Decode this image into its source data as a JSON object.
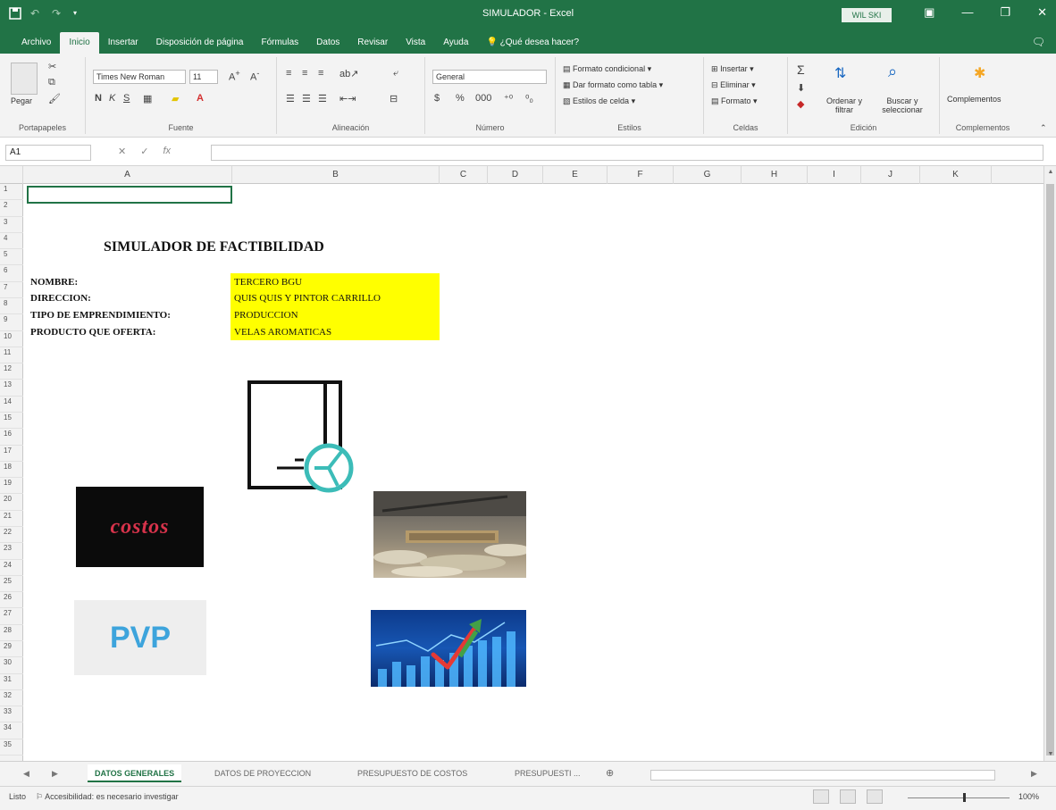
{
  "window": {
    "title": "SIMULADOR - Excel",
    "user": "WIL SKI"
  },
  "ribbon_tabs": [
    "Archivo",
    "Inicio",
    "Insertar",
    "Disposición de página",
    "Fórmulas",
    "Datos",
    "Revisar",
    "Vista",
    "Ayuda"
  ],
  "active_tab": "Inicio",
  "tell_me": "¿Qué desea hacer?",
  "ribbon": {
    "clipboard": {
      "paste": "Pegar",
      "label": "Portapapeles"
    },
    "font": {
      "name": "Times New Roman",
      "size": "11",
      "label": "Fuente"
    },
    "alignment": {
      "label": "Alineación"
    },
    "number": {
      "format": "General",
      "label": "Número"
    },
    "styles": {
      "conditional": "Formato condicional",
      "table": "Dar formato como tabla",
      "cell": "Estilos de celda",
      "label": "Estilos"
    },
    "cells": {
      "insert": "Insertar",
      "delete": "Eliminar",
      "format": "Formato",
      "label": "Celdas"
    },
    "editing": {
      "sort": "Ordenar y filtrar",
      "find": "Buscar y seleccionar",
      "label": "Edición"
    },
    "addins": {
      "label": "Complementos",
      "group": "Complementos"
    }
  },
  "formula_bar": {
    "name_box": "A1",
    "content": ""
  },
  "columns": [
    "A",
    "B",
    "C",
    "D",
    "E",
    "F",
    "G",
    "H",
    "I",
    "J",
    "K"
  ],
  "rows": [
    "1",
    "2",
    "3",
    "4",
    "5",
    "6",
    "7",
    "8",
    "9",
    "10",
    "11",
    "12",
    "13",
    "14",
    "15",
    "16",
    "17",
    "18",
    "19",
    "20",
    "21",
    "22",
    "23",
    "24",
    "25",
    "26",
    "27",
    "28",
    "29",
    "30",
    "31",
    "32",
    "33",
    "34",
    "35"
  ],
  "sheet": {
    "title": "SIMULADOR DE FACTIBILIDAD",
    "fields": [
      {
        "label": "NOMBRE:",
        "value": "TERCERO BGU"
      },
      {
        "label": "DIRECCION:",
        "value": "QUIS QUIS Y PINTOR CARRILLO"
      },
      {
        "label": "TIPO DE EMPRENDIMIENTO:",
        "value": "PRODUCCION"
      },
      {
        "label": "PRODUCTO QUE OFERTA:",
        "value": "VELAS AROMATICAS"
      }
    ],
    "images": {
      "costos": "costos",
      "pvp": "PVP"
    }
  },
  "sheet_tabs": [
    "DATOS GENERALES",
    "DATOS DE PROYECCION",
    "PRESUPUESTO DE COSTOS",
    "PRESUPUESTI ..."
  ],
  "active_sheet": "DATOS GENERALES",
  "status": {
    "mode": "Listo",
    "accessibility": "Accesibilidad: es necesario investigar",
    "zoom": "100%"
  },
  "colors": {
    "excel_green": "#217346",
    "highlight_yellow": "#ffff00"
  }
}
